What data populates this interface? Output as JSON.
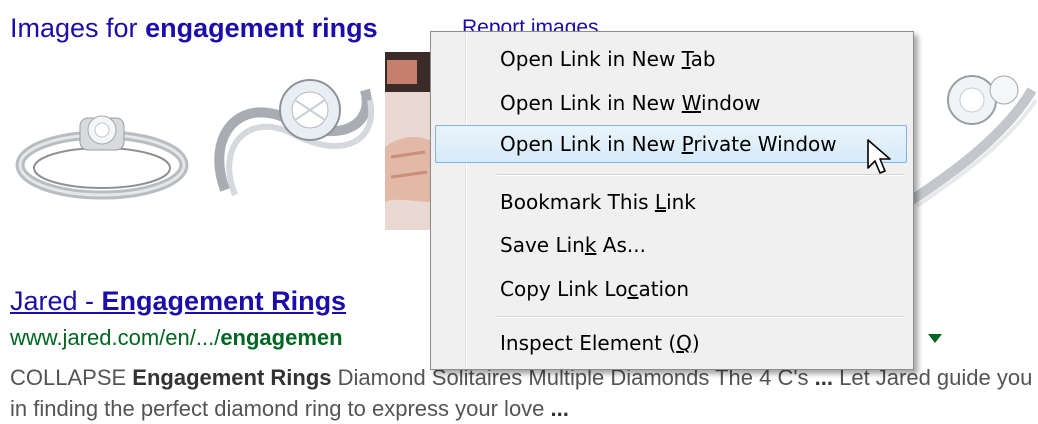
{
  "images_header": {
    "prefix": "Images for ",
    "query": "engagement rings",
    "report_label": "Report images"
  },
  "result": {
    "title_prefix": "Jared - ",
    "title_bold": "Engagement Rings",
    "url_prefix": "www.jared.com/en/.../",
    "url_bold": "engagemen",
    "snippet_p1": "COLLAPSE ",
    "snippet_b1": "Engagement Rings",
    "snippet_p2": " Diamond Solitaires Multiple Diamonds The 4 C's ",
    "snippet_b2": "...",
    "snippet_p3": " Let Jared guide you in finding the perfect diamond ring to express your love ",
    "snippet_b3": "..."
  },
  "context_menu": {
    "items": [
      {
        "pre": "Open Link in New ",
        "key": "T",
        "post": "ab"
      },
      {
        "pre": "Open Link in New ",
        "key": "W",
        "post": "indow"
      },
      {
        "pre": "Open Link in New ",
        "key": "P",
        "post": "rivate Window",
        "highlighted": true
      },
      {
        "pre": "Bookmark This ",
        "key": "L",
        "post": "ink"
      },
      {
        "pre": "Save Lin",
        "key": "k",
        "post": " As..."
      },
      {
        "pre": "Copy Link Lo",
        "key": "c",
        "post": "ation"
      },
      {
        "pre": "Inspect Element (",
        "key": "Q",
        "post": ")"
      }
    ]
  },
  "colors": {
    "link": "#1a0dab",
    "url_green": "#006621",
    "snippet_gray": "#545454",
    "menu_bg": "#f0f0f0",
    "menu_highlight_border": "#7eb4ea"
  },
  "icons": [
    "mouse-pointer-icon",
    "url-dropdown-arrow-icon"
  ]
}
